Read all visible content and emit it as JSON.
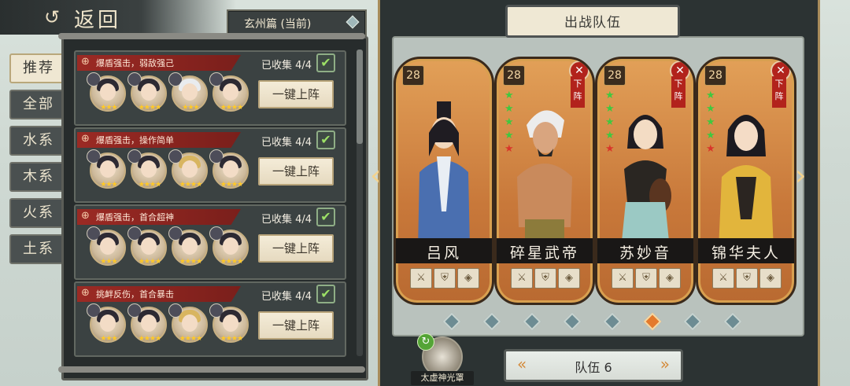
{
  "header": {
    "back_icon": "swirl-back-icon",
    "back_label": "返回",
    "chapter_label": "玄州篇 (当前)"
  },
  "filters": [
    {
      "label": "推荐",
      "active": true
    },
    {
      "label": "全部",
      "active": false
    },
    {
      "label": "水系",
      "active": false
    },
    {
      "label": "木系",
      "active": false
    },
    {
      "label": "火系",
      "active": false
    },
    {
      "label": "土系",
      "active": false
    }
  ],
  "recommended_teams": [
    {
      "tag": "爆盾强击，弱敌强己",
      "collected": "已收集 4/4",
      "deploy_label": "一键上阵",
      "members": [
        {
          "stars": "★★★"
        },
        {
          "stars": "★★★★"
        },
        {
          "stars": "★★★"
        },
        {
          "stars": "★★★★"
        }
      ]
    },
    {
      "tag": "爆盾强击，操作简单",
      "collected": "已收集 4/4",
      "deploy_label": "一键上阵",
      "members": [
        {
          "stars": "★★★"
        },
        {
          "stars": "★★★★"
        },
        {
          "stars": "★★★★"
        },
        {
          "stars": "★★★★"
        }
      ]
    },
    {
      "tag": "爆盾强击，首合超神",
      "collected": "已收集 4/4",
      "deploy_label": "一键上阵",
      "members": [
        {
          "stars": "★★★"
        },
        {
          "stars": "★★★★"
        },
        {
          "stars": "★★★★"
        },
        {
          "stars": "★★★★"
        }
      ]
    },
    {
      "tag": "挑衅反伤，首合暴击",
      "collected": "已收集 4/4",
      "deploy_label": "一键上阵",
      "members": [
        {
          "stars": "★★★"
        },
        {
          "stars": "★★★★"
        },
        {
          "stars": "★★★★"
        },
        {
          "stars": "★★★★"
        }
      ]
    }
  ],
  "team_panel": {
    "title": "出战队伍",
    "remove_label": "下阵",
    "heroes": [
      {
        "name": "吕风",
        "level": "28",
        "removable": false,
        "stars": 0
      },
      {
        "name": "碎星武帝",
        "level": "28",
        "removable": true,
        "stars": 5
      },
      {
        "name": "苏妙音",
        "level": "28",
        "removable": true,
        "stars": 5
      },
      {
        "name": "锦华夫人",
        "level": "28",
        "removable": true,
        "stars": 5
      }
    ],
    "page_count": 8,
    "active_page_index": 5,
    "team_label": "队伍 6",
    "skill_label": "太虚神光罩"
  },
  "colors": {
    "accent_red": "#b2231c",
    "card_orange": "#c8783a",
    "active_dot": "#e47a2c"
  }
}
